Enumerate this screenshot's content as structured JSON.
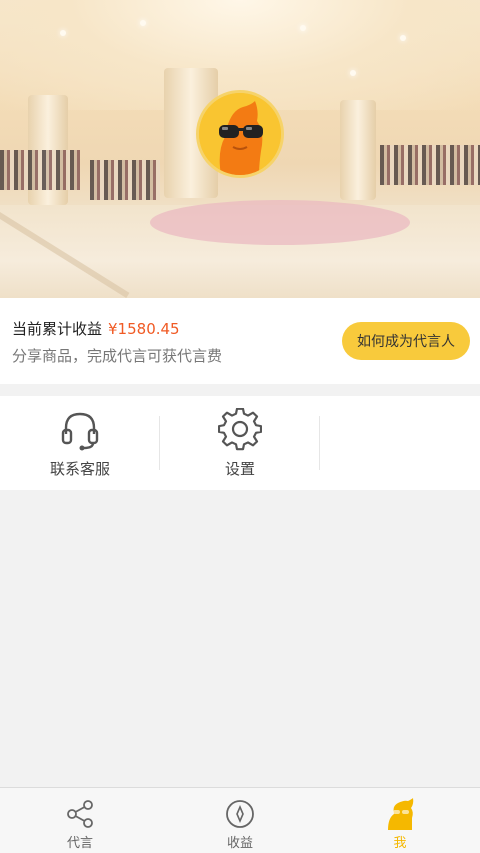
{
  "earnings": {
    "title": "当前累计收益",
    "amount": "¥1580.45",
    "subtitle": "分享商品，完成代言可获代言费",
    "cta_label": "如何成为代言人"
  },
  "tools": [
    {
      "label": "联系客服",
      "icon": "headset-icon"
    },
    {
      "label": "设置",
      "icon": "gear-icon"
    }
  ],
  "tabbar": {
    "items": [
      {
        "label": "代言",
        "icon": "share-icon",
        "active": false
      },
      {
        "label": "收益",
        "icon": "compass-icon",
        "active": false
      },
      {
        "label": "我",
        "icon": "profile-icon",
        "active": true
      }
    ]
  },
  "colors": {
    "accent": "#f8ca3c",
    "amount": "#f05a24",
    "active_tab": "#f5b800"
  }
}
